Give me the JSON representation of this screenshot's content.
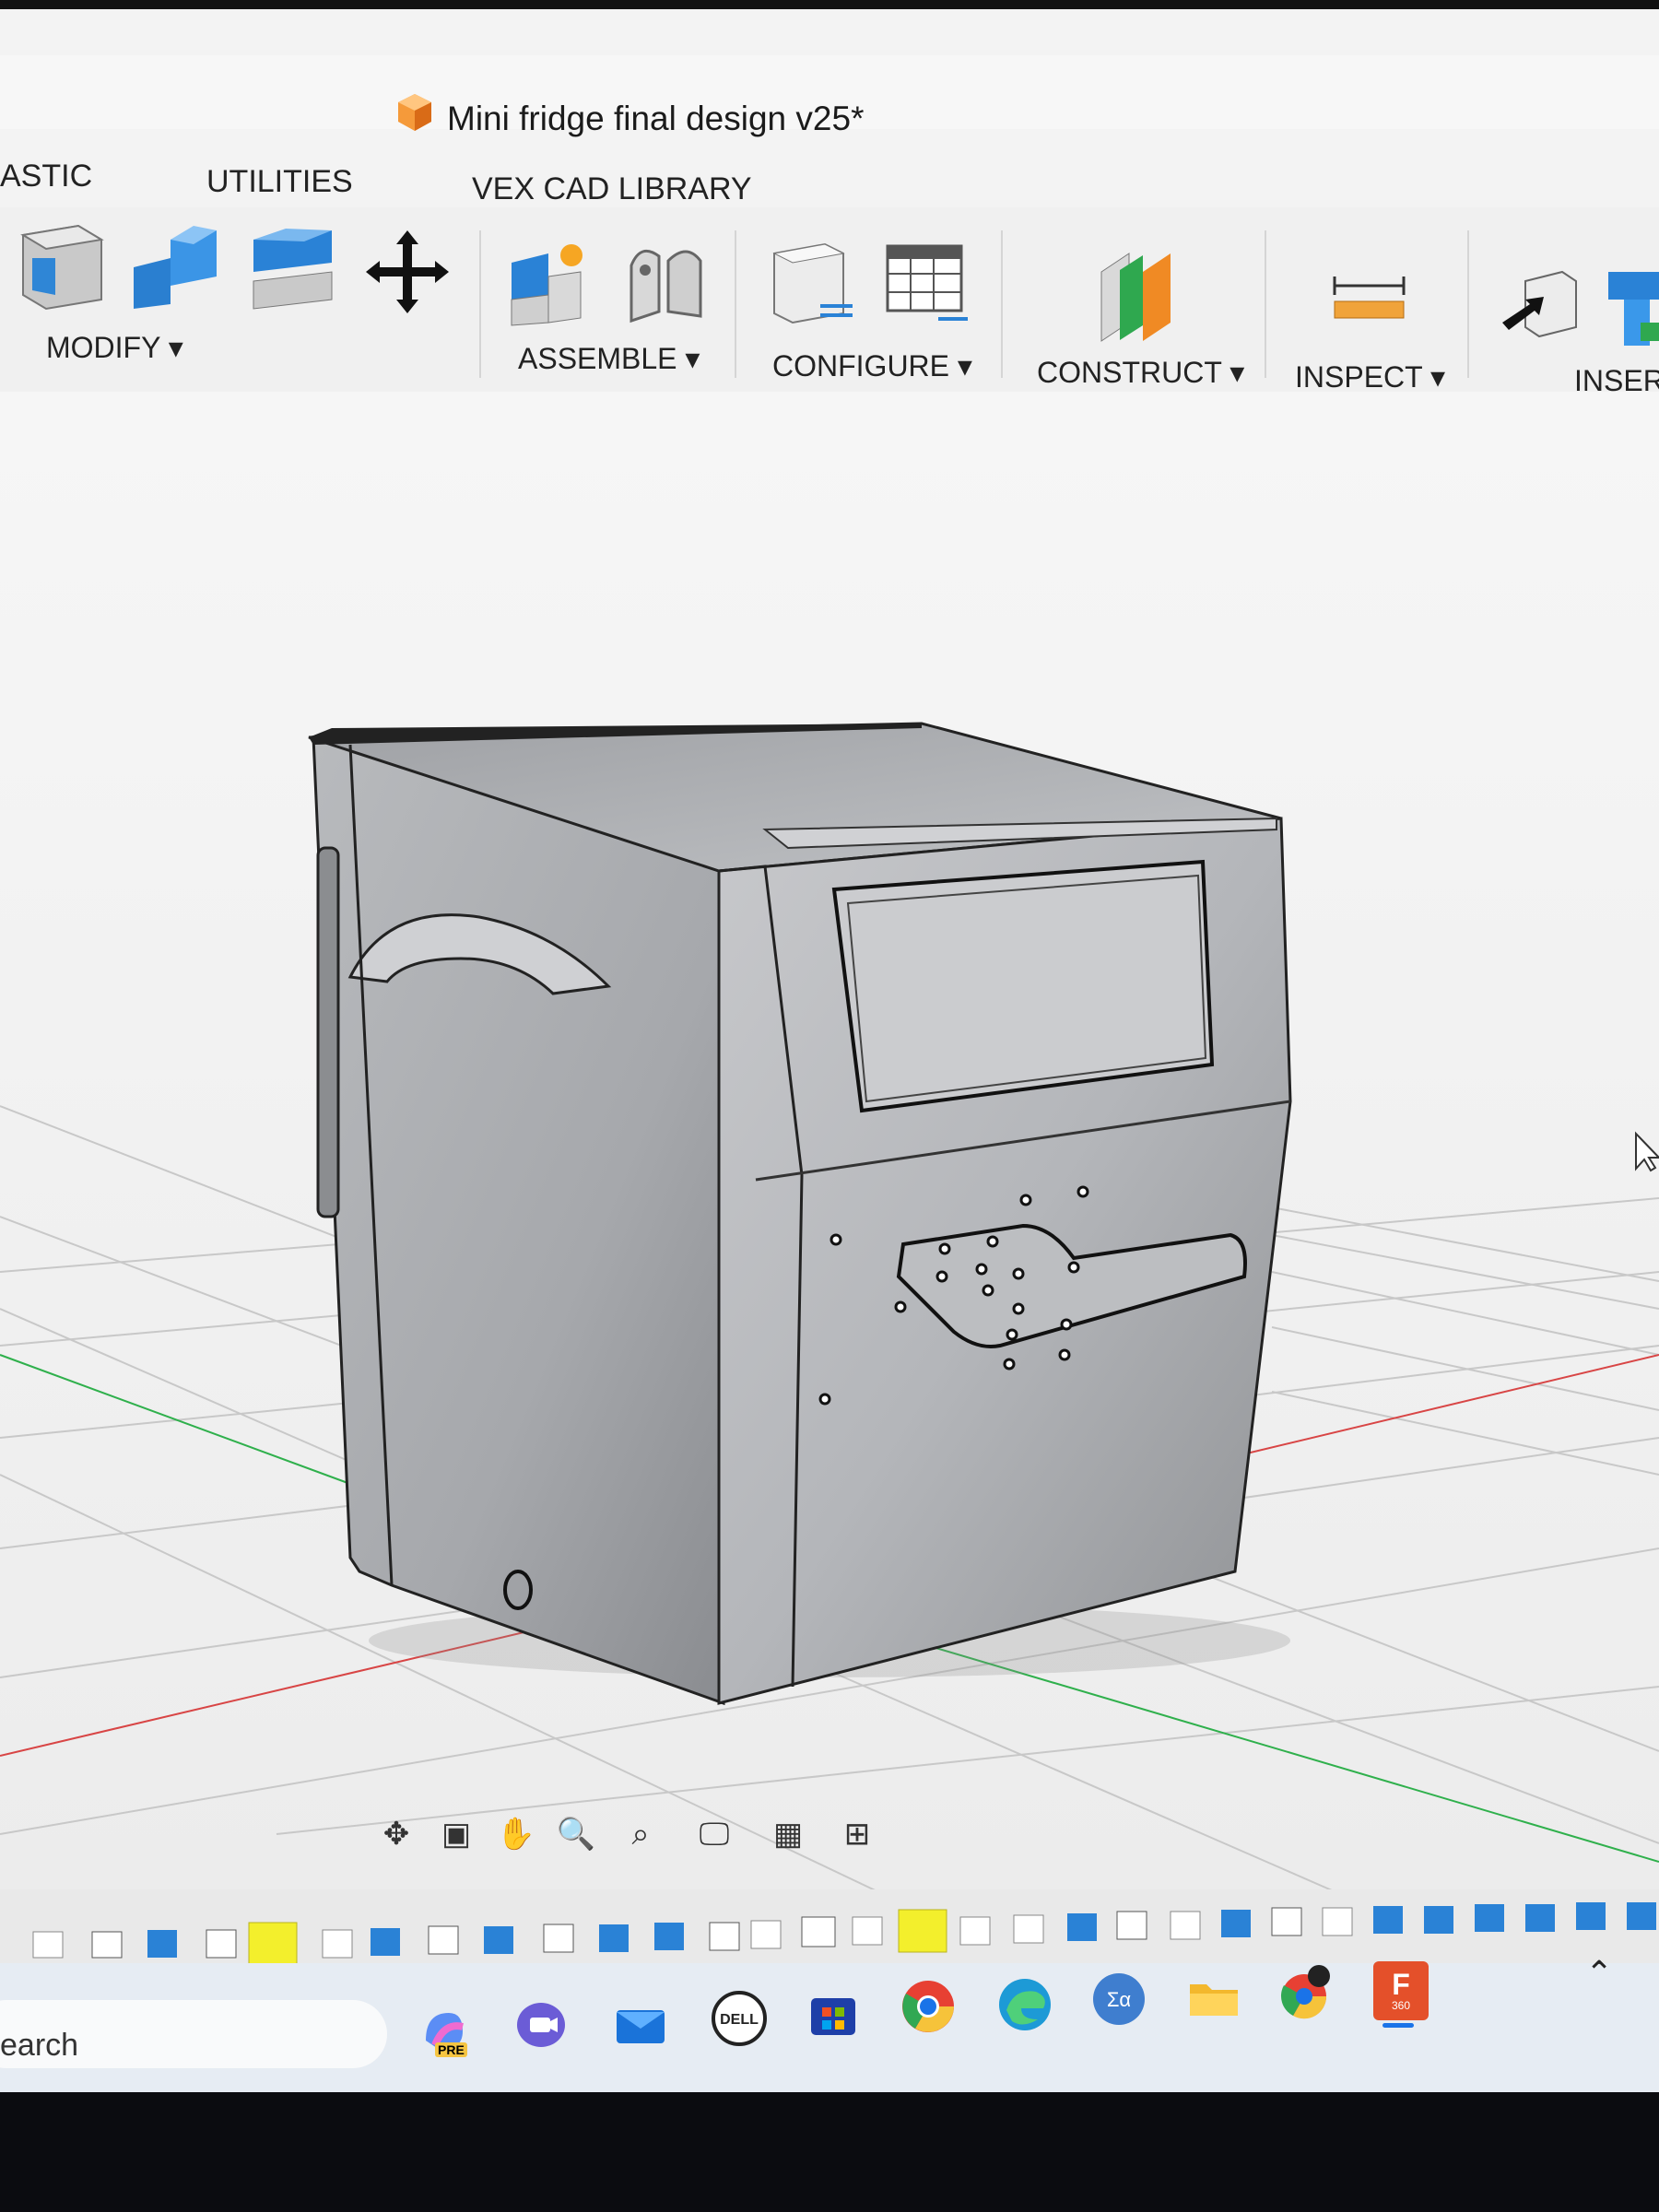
{
  "window": {
    "document_title": "Mini fridge final design v25*"
  },
  "tabs": [
    {
      "label": "ASTIC"
    },
    {
      "label": "UTILITIES"
    },
    {
      "label": "VEX CAD LIBRARY"
    }
  ],
  "toolbar": {
    "groups": [
      {
        "label": "MODIFY ▾"
      },
      {
        "label": "ASSEMBLE ▾"
      },
      {
        "label": "CONFIGURE ▾"
      },
      {
        "label": "CONSTRUCT ▾"
      },
      {
        "label": "INSPECT ▾"
      },
      {
        "label": "INSERT"
      }
    ]
  },
  "navbar": {
    "icons": [
      "orbit-icon",
      "look-at-icon",
      "pan-icon",
      "zoom-icon",
      "fit-icon",
      "display-settings-icon",
      "grid-settings-icon",
      "viewports-icon"
    ]
  },
  "taskbar": {
    "search_label": "earch",
    "apps": [
      "copilot-icon",
      "teams-icon",
      "mail-icon",
      "dell-icon",
      "store-icon",
      "chrome-icon",
      "edge-icon",
      "calculator-icon",
      "file-explorer-icon",
      "chrome-profile-icon",
      "fusion360-icon"
    ],
    "fusion_label": "F",
    "fusion_sub": "360",
    "copilot_badge": "PRE"
  },
  "colors": {
    "accent_orange": "#f08a24",
    "fusion_red": "#e4502a",
    "body_gray": "#b9babd"
  }
}
